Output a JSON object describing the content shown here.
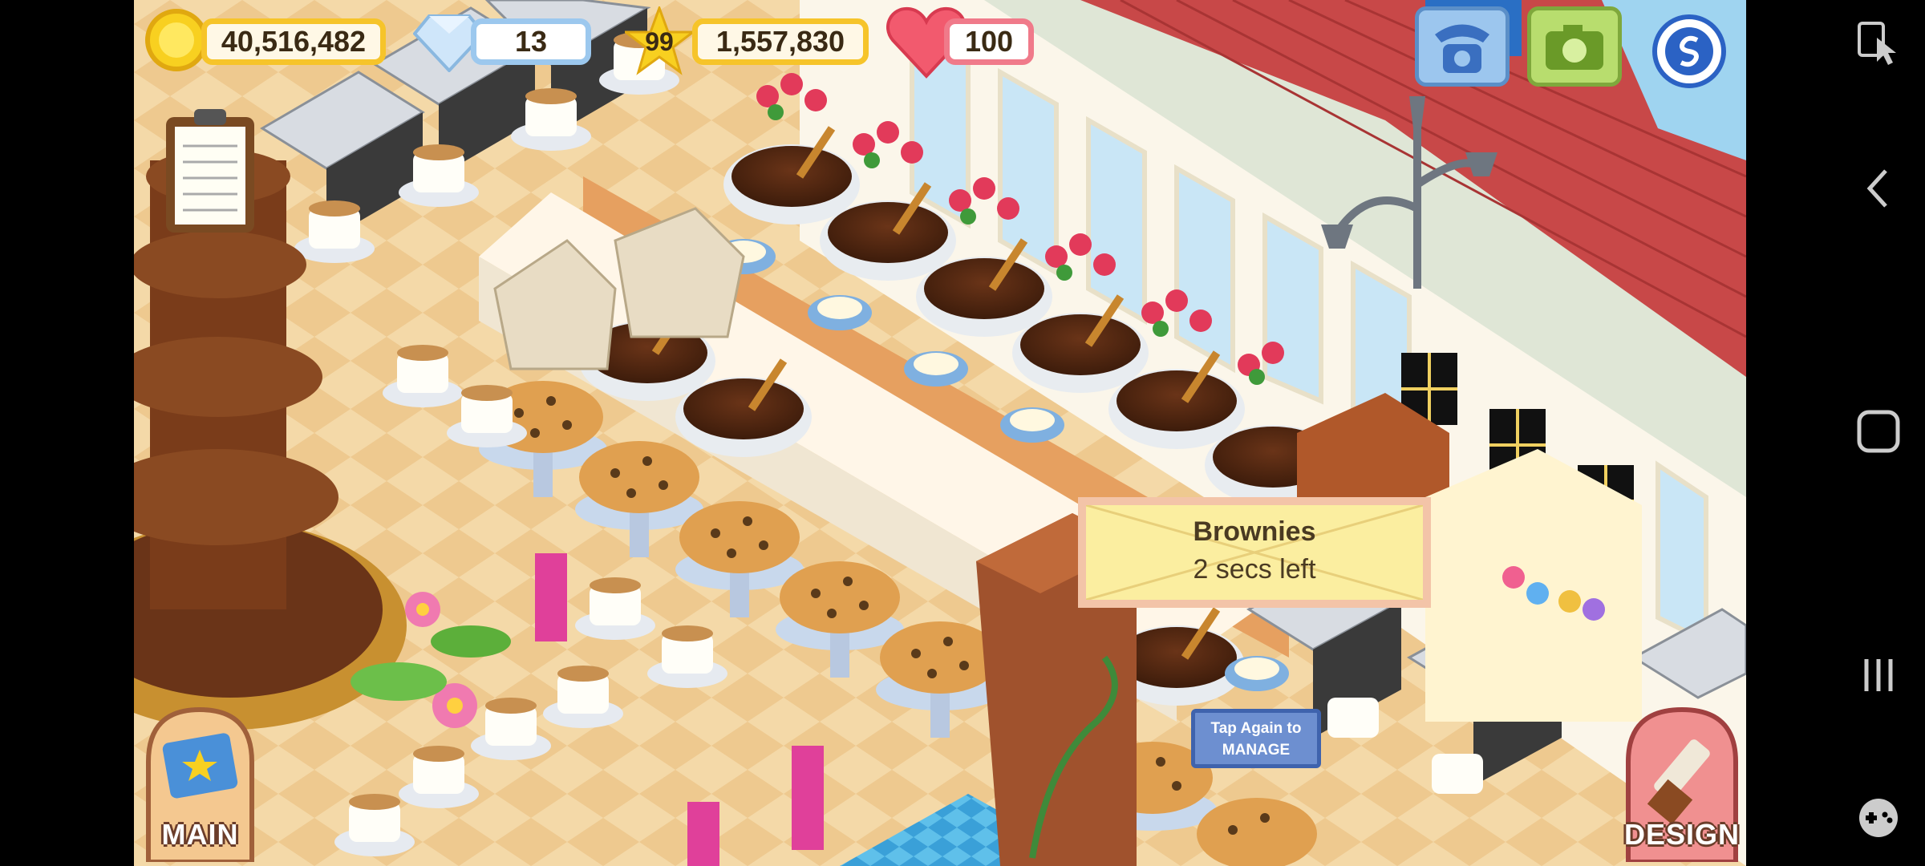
{
  "hud": {
    "coins": "40,516,482",
    "gems": "13",
    "level": "99",
    "xp": "1,557,830",
    "hearts": "100"
  },
  "icons": {
    "coin": "coin-icon",
    "gem": "gem-icon",
    "star": "star-icon",
    "heart": "heart-icon",
    "phone": "phone-icon",
    "camera": "camera-icon",
    "social": "social-icon",
    "clipboard": "clipboard-icon"
  },
  "tooltip": {
    "title": "Brownies",
    "subtitle": "2 secs left"
  },
  "manage_tag": {
    "line1": "Tap Again to",
    "line2": "MANAGE"
  },
  "buttons": {
    "main": "MAIN",
    "design": "DESIGN"
  },
  "colors": {
    "coin_border": "#f6c42a",
    "gem_border": "#9cc8ee",
    "heart_border": "#f07a8a",
    "tooltip_bg": "#fbeea0",
    "manage_bg": "#6d8fd0"
  }
}
